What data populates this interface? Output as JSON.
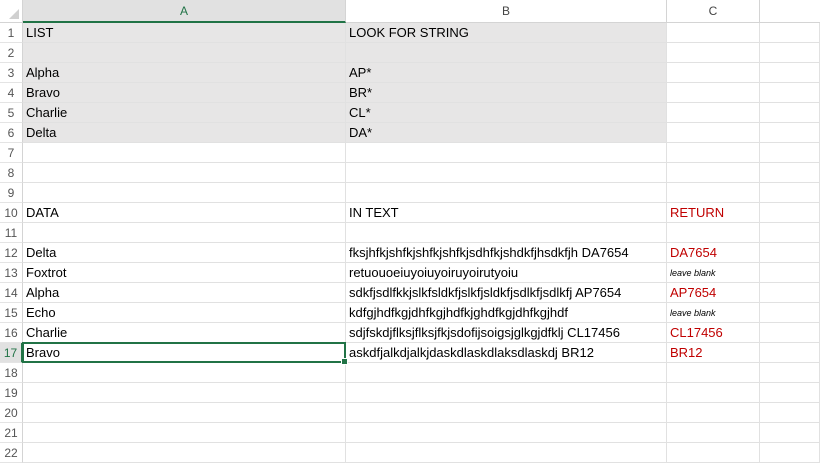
{
  "columns": [
    "A",
    "B",
    "C"
  ],
  "selected_cell": "A17",
  "rows": [
    {
      "n": "1",
      "a": "LIST",
      "b": "LOOK FOR STRING",
      "c": "",
      "fill": true
    },
    {
      "n": "2",
      "a": "",
      "b": "",
      "c": "",
      "fill": true
    },
    {
      "n": "3",
      "a": "Alpha",
      "b": "AP*",
      "c": "",
      "fill": true
    },
    {
      "n": "4",
      "a": "Bravo",
      "b": "BR*",
      "c": "",
      "fill": true
    },
    {
      "n": "5",
      "a": "Charlie",
      "b": "CL*",
      "c": "",
      "fill": true
    },
    {
      "n": "6",
      "a": "Delta",
      "b": "DA*",
      "c": "",
      "fill": true
    },
    {
      "n": "7",
      "a": "",
      "b": "",
      "c": ""
    },
    {
      "n": "8",
      "a": "",
      "b": "",
      "c": ""
    },
    {
      "n": "9",
      "a": "",
      "b": "",
      "c": ""
    },
    {
      "n": "10",
      "a": "DATA",
      "b": "IN TEXT",
      "c": "RETURN",
      "cstyle": "red"
    },
    {
      "n": "11",
      "a": "",
      "b": "",
      "c": ""
    },
    {
      "n": "12",
      "a": "Delta",
      "b": "fksjhfkjshfkjshfkjshfkjsdhfkjshdkfjhsdkfjh DA7654",
      "c": "DA7654",
      "cstyle": "red"
    },
    {
      "n": "13",
      "a": "Foxtrot",
      "b": "retuouoeiuyoiuyoiruyoirutyoiu",
      "c": "leave blank",
      "cstyle": "note"
    },
    {
      "n": "14",
      "a": "Alpha",
      "b": "sdkfjsdlfkkjslkfsldkfjslkfjsldkfjsdlkfjsdlkfj AP7654",
      "c": "AP7654",
      "cstyle": "red"
    },
    {
      "n": "15",
      "a": "Echo",
      "b": "kdfgjhdfkgjdhfkgjhdfkjghdfkgjdhfkgjhdf",
      "c": "leave blank",
      "cstyle": "note"
    },
    {
      "n": "16",
      "a": "Charlie",
      "b": "sdjfskdjflksjflksjfkjsdofijsoigsjglkgjdfklj CL17456",
      "c": "CL17456",
      "cstyle": "red"
    },
    {
      "n": "17",
      "a": "Bravo",
      "b": "askdfjalkdjalkjdaskdlaskdlaksdlaskdj BR12",
      "c": "BR12",
      "cstyle": "red"
    },
    {
      "n": "18",
      "a": "",
      "b": "",
      "c": ""
    },
    {
      "n": "19",
      "a": "",
      "b": "",
      "c": ""
    },
    {
      "n": "20",
      "a": "",
      "b": "",
      "c": ""
    },
    {
      "n": "21",
      "a": "",
      "b": "",
      "c": ""
    },
    {
      "n": "22",
      "a": "",
      "b": "",
      "c": ""
    }
  ]
}
